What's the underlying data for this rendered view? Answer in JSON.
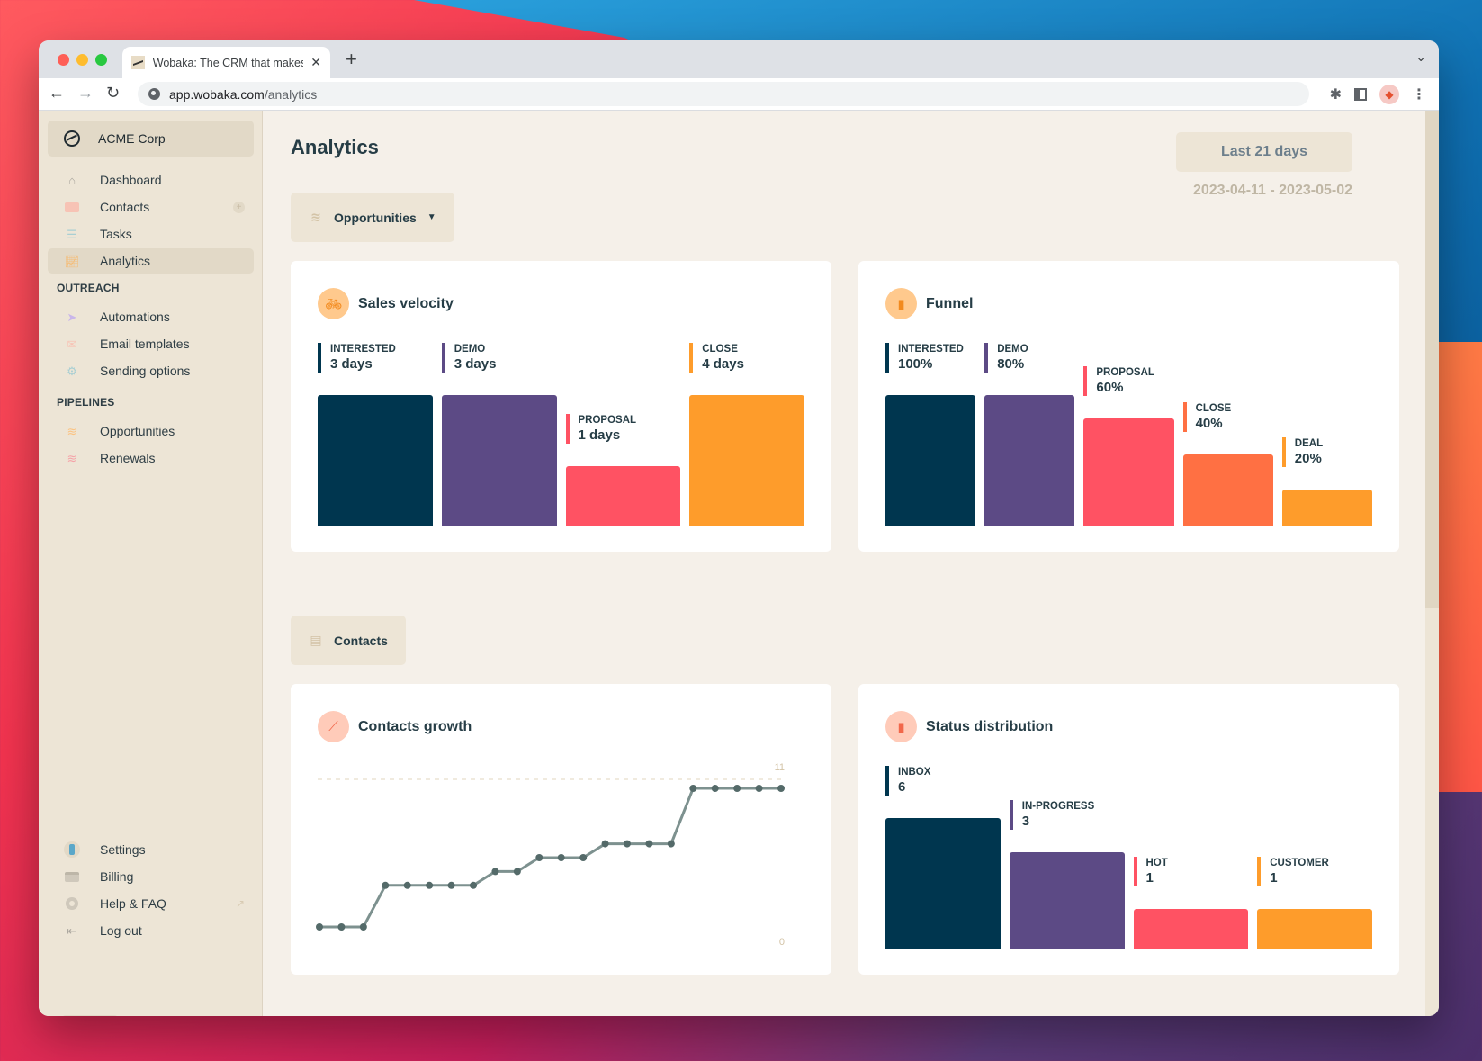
{
  "browser": {
    "tab_title": "Wobaka: The CRM that makes you",
    "url_host": "app.wobaka.com",
    "url_path": "/analytics"
  },
  "sidebar": {
    "org_name": "ACME Corp",
    "main_items": [
      {
        "label": "Dashboard",
        "icon": "home-icon"
      },
      {
        "label": "Contacts",
        "icon": "contact-card-icon",
        "badge": "+"
      },
      {
        "label": "Tasks",
        "icon": "checklist-icon"
      },
      {
        "label": "Analytics",
        "icon": "analytics-icon",
        "active": true
      }
    ],
    "outreach_title": "OUTREACH",
    "outreach_items": [
      {
        "label": "Automations",
        "icon": "paper-plane-icon"
      },
      {
        "label": "Email templates",
        "icon": "envelope-icon"
      },
      {
        "label": "Sending options",
        "icon": "gears-icon"
      }
    ],
    "pipelines_title": "PIPELINES",
    "pipelines_items": [
      {
        "label": "Opportunities",
        "icon": "layers-icon"
      },
      {
        "label": "Renewals",
        "icon": "layers-icon"
      }
    ],
    "bottom_items": [
      {
        "label": "Settings",
        "icon": "settings-icon"
      },
      {
        "label": "Billing",
        "icon": "credit-card-icon"
      },
      {
        "label": "Help & FAQ",
        "icon": "lifebuoy-icon",
        "external": true
      },
      {
        "label": "Log out",
        "icon": "logout-icon"
      }
    ],
    "theme": {
      "options": [
        "dark",
        "auto"
      ],
      "selected": "auto"
    }
  },
  "header": {
    "title": "Analytics",
    "range_label": "Last 21 days",
    "range_dates": "2023-04-11 - 2023-05-02"
  },
  "sections": {
    "opportunities_label": "Opportunities",
    "contacts_label": "Contacts"
  },
  "colors": {
    "navy": "#00364f",
    "purple": "#5c4a85",
    "red": "#ff5263",
    "coral": "#ff7043",
    "orange": "#fe9c2b",
    "icon_orange_bg": "#ffc98d",
    "icon_peach_bg": "#ffcbb9",
    "line": "#7d918f",
    "dot": "#546a69"
  },
  "chart_data": [
    {
      "type": "bar",
      "title": "Sales velocity",
      "categories": [
        "INTERESTED",
        "DEMO",
        "PROPOSAL",
        "CLOSE"
      ],
      "values": [
        3,
        3,
        1,
        4
      ],
      "display": [
        "3 days",
        "3 days",
        "1 days",
        "4 days"
      ],
      "relative_heights": [
        1.0,
        1.0,
        0.46,
        1.0
      ],
      "colors": [
        "#00364f",
        "#5c4a85",
        "#ff5263",
        "#fe9c2b"
      ]
    },
    {
      "type": "bar",
      "title": "Funnel",
      "categories": [
        "INTERESTED",
        "DEMO",
        "PROPOSAL",
        "CLOSE",
        "DEAL"
      ],
      "values": [
        100,
        80,
        60,
        40,
        20
      ],
      "display": [
        "100%",
        "80%",
        "60%",
        "40%",
        "20%"
      ],
      "relative_heights": [
        1.0,
        1.0,
        0.82,
        0.55,
        0.28
      ],
      "colors": [
        "#00364f",
        "#5c4a85",
        "#ff5263",
        "#ff7043",
        "#fe9c2b"
      ]
    },
    {
      "type": "line",
      "title": "Contacts growth",
      "x": [
        1,
        2,
        3,
        4,
        5,
        6,
        7,
        8,
        9,
        10,
        11,
        12,
        13,
        14,
        15,
        16,
        17,
        18,
        19,
        20,
        21,
        22
      ],
      "values": [
        1,
        1,
        1,
        4,
        4,
        4,
        4,
        4,
        5,
        5,
        6,
        6,
        6,
        7,
        7,
        7,
        7,
        11,
        11,
        11,
        11,
        11
      ],
      "ylim": [
        0,
        11
      ],
      "ytick_labels": [
        "0",
        "11"
      ],
      "reference_line": 11
    },
    {
      "type": "bar",
      "title": "Status distribution",
      "categories": [
        "INBOX",
        "IN-PROGRESS",
        "HOT",
        "CUSTOMER"
      ],
      "values": [
        6,
        3,
        1,
        1
      ],
      "display": [
        "6",
        "3",
        "1",
        "1"
      ],
      "relative_heights": [
        1.0,
        0.74,
        0.31,
        0.31
      ],
      "colors": [
        "#00364f",
        "#5c4a85",
        "#ff5263",
        "#fe9c2b"
      ]
    }
  ]
}
